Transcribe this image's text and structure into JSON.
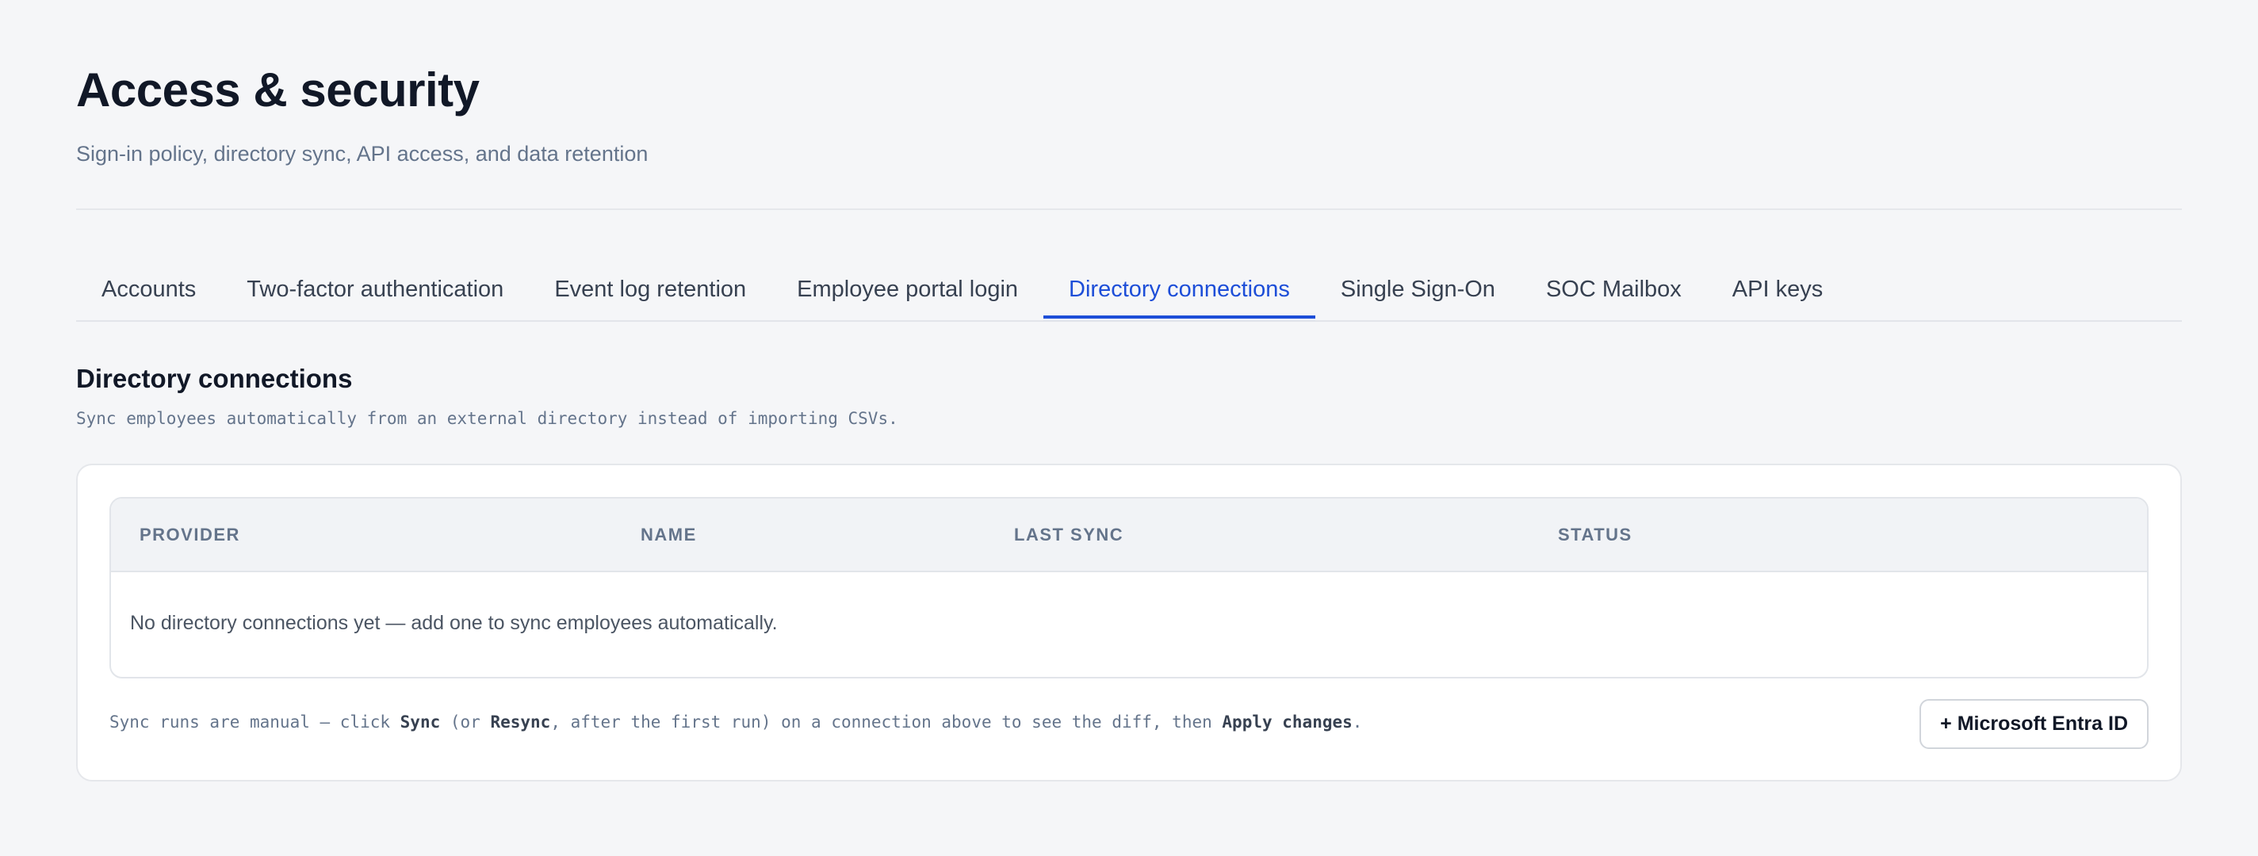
{
  "header": {
    "title": "Access & security",
    "subtitle": "Sign-in policy, directory sync, API access, and data retention"
  },
  "tabs": [
    {
      "label": "Accounts",
      "active": false
    },
    {
      "label": "Two-factor authentication",
      "active": false
    },
    {
      "label": "Event log retention",
      "active": false
    },
    {
      "label": "Employee portal login",
      "active": false
    },
    {
      "label": "Directory connections",
      "active": true
    },
    {
      "label": "Single Sign-On",
      "active": false
    },
    {
      "label": "SOC Mailbox",
      "active": false
    },
    {
      "label": "API keys",
      "active": false
    }
  ],
  "section": {
    "title": "Directory connections",
    "description": "Sync employees automatically from an external directory instead of importing CSVs."
  },
  "table": {
    "columns": {
      "provider": "PROVIDER",
      "name": "NAME",
      "last_sync": "LAST SYNC",
      "status": "STATUS"
    },
    "rows": [],
    "empty_message": "No directory connections yet — add one to sync employees automatically."
  },
  "footer": {
    "note_part1": "Sync runs are manual — click ",
    "note_sync": "Sync",
    "note_part2": " (or ",
    "note_resync": "Resync",
    "note_part3": ", after the first run) on a connection above to see the diff, then ",
    "note_apply": "Apply changes",
    "note_part4": ".",
    "add_button_label": "+ Microsoft Entra ID"
  },
  "colors": {
    "accent": "#1d4ed8",
    "background": "#f5f6f8",
    "muted_text": "#64748b"
  }
}
